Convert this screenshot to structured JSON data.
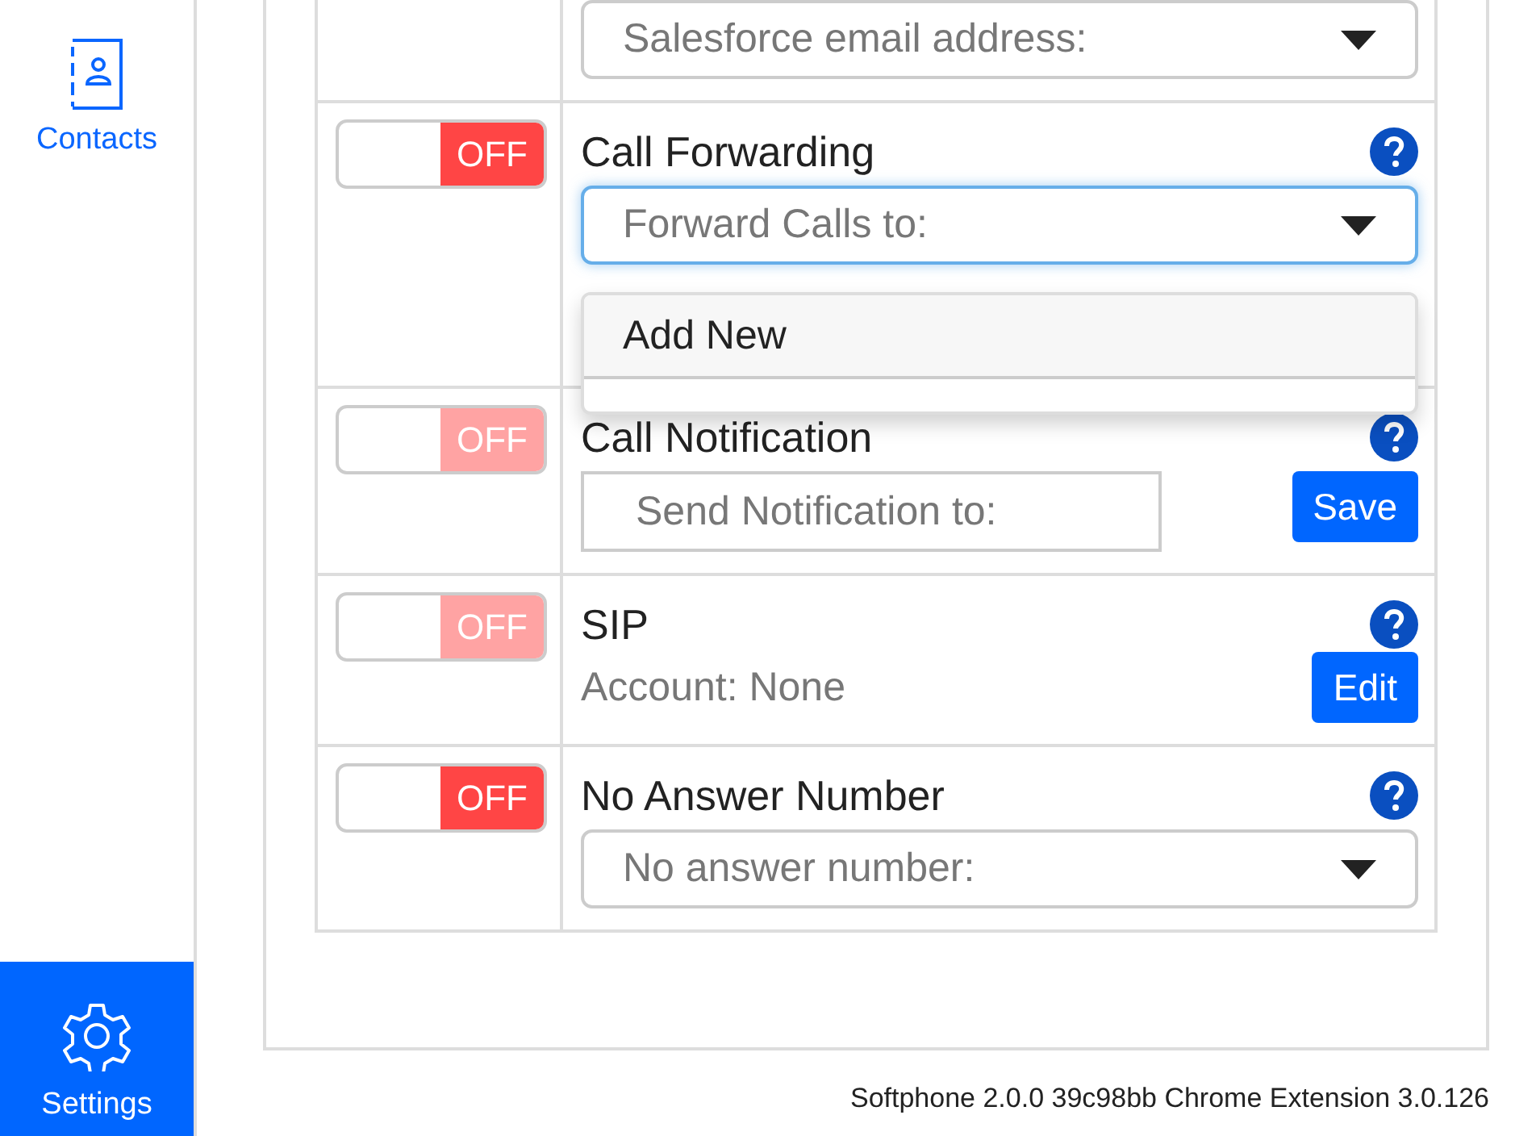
{
  "sidebar": {
    "items": [
      {
        "label": "Contacts",
        "selected": false
      },
      {
        "label": "Settings",
        "selected": true
      }
    ]
  },
  "settings": [
    {
      "kind": "select",
      "placeholder": "Salesforce email address:"
    },
    {
      "kind": "select",
      "title": "Call Forwarding",
      "toggle": {
        "label": "OFF",
        "on": false,
        "disabled": false
      },
      "help": true,
      "placeholder": "Forward Calls to:",
      "focused": true,
      "expanded": true,
      "menu": [
        "Add New"
      ]
    },
    {
      "kind": "input",
      "title": "Call Notification",
      "toggle": {
        "label": "OFF",
        "on": false,
        "disabled": true
      },
      "help": true,
      "placeholder": "Send Notification to:",
      "button": "Save"
    },
    {
      "kind": "text",
      "title": "SIP",
      "toggle": {
        "label": "OFF",
        "on": false,
        "disabled": true
      },
      "help": true,
      "detail": "Account: None",
      "button": "Edit"
    },
    {
      "kind": "select",
      "title": "No Answer Number",
      "toggle": {
        "label": "OFF",
        "on": false,
        "disabled": false
      },
      "help": true,
      "placeholder": "No answer number:",
      "focused": false
    }
  ],
  "footer": "Softphone 2.0.0 39c98bb Chrome Extension 3.0.126"
}
